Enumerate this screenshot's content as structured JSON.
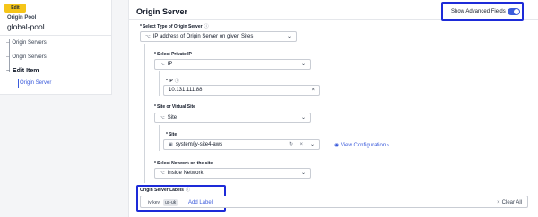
{
  "sidebar": {
    "badge": "Edit",
    "pool_label": "Origin Pool",
    "pool_name": "global-pool",
    "items": [
      {
        "label": "Origin Servers"
      },
      {
        "label": "Origin Servers"
      },
      {
        "label": "Edit Item"
      },
      {
        "label": "Origin Server"
      }
    ]
  },
  "header": {
    "title": "Origin Server",
    "advanced_label": "Show Advanced Fields",
    "advanced_on": true
  },
  "form": {
    "type": {
      "label": "Select Type of Origin Server",
      "value": "IP address of Origin Server on given Sites"
    },
    "private_ip": {
      "label": "Select Private IP",
      "value": "IP"
    },
    "ip": {
      "label": "IP",
      "value": "10.131.111.88"
    },
    "site_or_vsite": {
      "label": "Site or Virtual Site",
      "value": "Site"
    },
    "site": {
      "label": "Site",
      "value": "system/jy-site4-aws"
    },
    "view_config": "View Configuration",
    "network": {
      "label": "Select Network on the site",
      "value": "Inside Network"
    },
    "labels": {
      "title": "Origin Server Labels",
      "key": "jy-key",
      "value": "us-uk",
      "add": "Add Label",
      "clear": "Clear All"
    }
  },
  "colors": {
    "accent": "#3b5bdb",
    "highlight_border": "#1d2bd8",
    "badge": "#f5c518"
  }
}
